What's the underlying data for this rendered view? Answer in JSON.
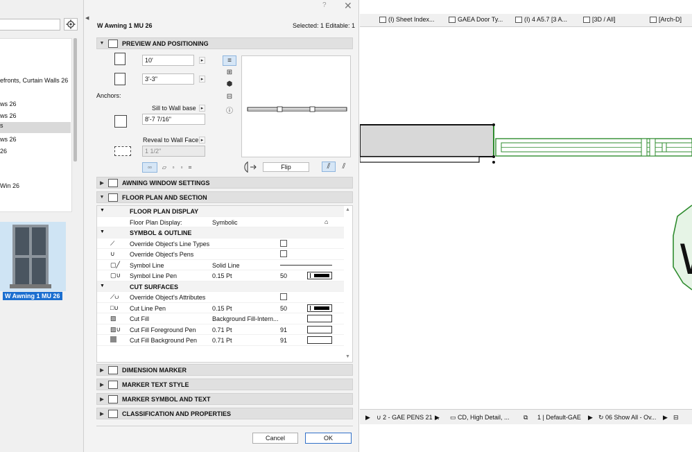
{
  "library": {
    "tree_items": [
      {
        "label": "efronts, Curtain Walls 26",
        "selected": false
      },
      {
        "label": "ws 26",
        "selected": false
      },
      {
        "label": "ws 26",
        "selected": false
      },
      {
        "label": "s",
        "selected": true
      },
      {
        "label": "ws 26",
        "selected": false
      },
      {
        "label": "26",
        "selected": false
      },
      {
        "label": "Win 26",
        "selected": false
      }
    ],
    "preview_label": "W Awning 1 MU 26",
    "icons": {
      "gear": "gear-icon"
    }
  },
  "dialog": {
    "help_glyph": "?",
    "close_glyph": "✕",
    "title": "W Awning 1 MU 26",
    "selected_status": "Selected: 1 Editable: 1",
    "preview_section": {
      "header": "PREVIEW AND POSITIONING",
      "width_value": "10'",
      "height_value": "3'-3\"",
      "anchors_label": "Anchors:",
      "sill_mode": "Sill to Wall base",
      "sill_value": "8'-7 7/16\"",
      "reveal_mode": "Reveal to Wall Face",
      "reveal_value": "1 1/2\"",
      "flip_label": "Flip"
    },
    "collapsed_sections": [
      {
        "name": "awning-window-settings",
        "label": "AWNING WINDOW SETTINGS"
      }
    ],
    "floor_plan_section": {
      "header": "FLOOR PLAN AND SECTION",
      "rows": [
        {
          "kind": "group",
          "label": "FLOOR PLAN DISPLAY"
        },
        {
          "kind": "value",
          "label": "Floor Plan Display:",
          "value": "Symbolic"
        },
        {
          "kind": "group",
          "label": "SYMBOL & OUTLINE"
        },
        {
          "kind": "check",
          "label": "Override Object's Line Types",
          "checked": false
        },
        {
          "kind": "check",
          "label": "Override Object's Pens",
          "checked": false
        },
        {
          "kind": "line",
          "label": "Symbol Line",
          "value": "Solid Line"
        },
        {
          "kind": "pen",
          "label": "Symbol Line Pen",
          "value": "0.15 Pt",
          "num": "50"
        },
        {
          "kind": "group",
          "label": "CUT SURFACES"
        },
        {
          "kind": "check",
          "label": "Override Object's Attributes",
          "checked": false
        },
        {
          "kind": "pen",
          "label": "Cut Line Pen",
          "value": "0.15 Pt",
          "num": "50"
        },
        {
          "kind": "fill",
          "label": "Cut Fill",
          "value": "Background Fill-Intern...",
          "num": ""
        },
        {
          "kind": "fill",
          "label": "Cut Fill Foreground Pen",
          "value": "0.71 Pt",
          "num": "91"
        },
        {
          "kind": "fill",
          "label": "Cut Fill Background Pen",
          "value": "0.71 Pt",
          "num": "91"
        }
      ]
    },
    "lower_sections": [
      {
        "name": "dimension-marker",
        "label": "DIMENSION MARKER"
      },
      {
        "name": "marker-text-style",
        "label": "MARKER TEXT STYLE"
      },
      {
        "name": "marker-symbol-and-text",
        "label": "MARKER SYMBOL AND TEXT"
      },
      {
        "name": "classification-and-properties",
        "label": "CLASSIFICATION AND PROPERTIES"
      }
    ],
    "buttons": {
      "cancel": "Cancel",
      "ok": "OK"
    }
  },
  "view_tabs": [
    {
      "label": "(I) Sheet Index...",
      "icon": "sheet-icon"
    },
    {
      "label": "GAEA Door Ty...",
      "icon": "grid-icon"
    },
    {
      "label": "(I) 4 A5.7  [3 A...",
      "icon": "elevation-icon"
    },
    {
      "label": "[3D / All]",
      "icon": "cube-icon"
    },
    {
      "label": "[Arch-D]",
      "icon": "layout-icon"
    }
  ],
  "status_bar": [
    {
      "label": "2 - GAE PENS 21 ...",
      "icon": "pen-icon"
    },
    {
      "label": "CD, High Detail, ...",
      "icon": "model-view-icon"
    },
    {
      "label": "1 | Default-GAE",
      "icon": "layer-icon"
    },
    {
      "label": "06 Show All - Ov...",
      "icon": "renovation-icon"
    }
  ],
  "colors": {
    "selection_blue": "#1c6fd0",
    "drawing_green": "#2e8b2e",
    "wall_gray": "#d8d8d8"
  }
}
